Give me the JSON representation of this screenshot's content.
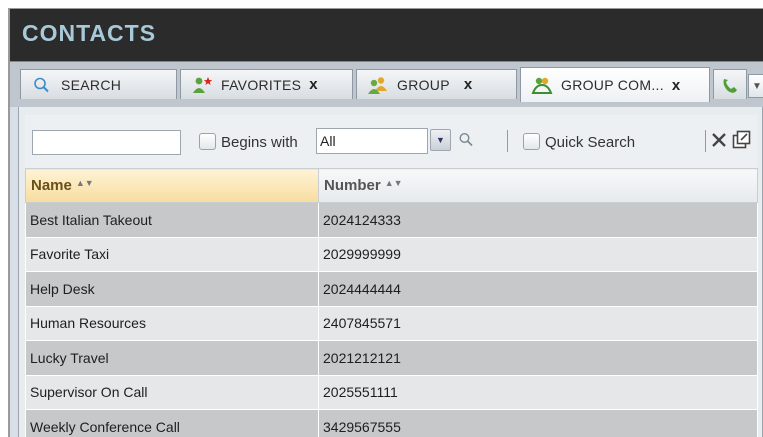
{
  "window": {
    "title": "CONTACTS"
  },
  "tabs": [
    {
      "label": "SEARCH",
      "icon": "magnifier-icon",
      "closable": false
    },
    {
      "label": "FAVORITES",
      "icon": "favorites-people-icon",
      "closable": true,
      "close": "x"
    },
    {
      "label": "GROUP",
      "icon": "group-people-icon",
      "closable": true,
      "close": "x"
    },
    {
      "label": "GROUP COM...",
      "icon": "group-common-phone-icon",
      "closable": true,
      "close": "x",
      "active": true
    }
  ],
  "filter": {
    "search_value": "",
    "begins_with_label": "Begins with",
    "begins_with_checked": false,
    "scope_selected": "All",
    "quick_search_label": "Quick Search",
    "quick_search_checked": false
  },
  "table": {
    "columns": [
      "Name",
      "Number"
    ],
    "sorted_column": "Name",
    "rows": [
      {
        "name": "Best Italian Takeout",
        "number": "2024124333"
      },
      {
        "name": "Favorite Taxi",
        "number": "2029999999"
      },
      {
        "name": "Help Desk",
        "number": "2024444444"
      },
      {
        "name": "Human Resources",
        "number": "2407845571"
      },
      {
        "name": "Lucky Travel",
        "number": "2021212121"
      },
      {
        "name": "Supervisor On Call",
        "number": "2025551111"
      },
      {
        "name": "Weekly Conference Call",
        "number": "3429567555"
      }
    ]
  },
  "colors": {
    "title_bar": "#2b2b2b",
    "title_text": "#a8c9d8",
    "sorted_header": "#f7dc9e",
    "row_dark": "#c7c8c9",
    "row_light": "#e6e7e8"
  }
}
